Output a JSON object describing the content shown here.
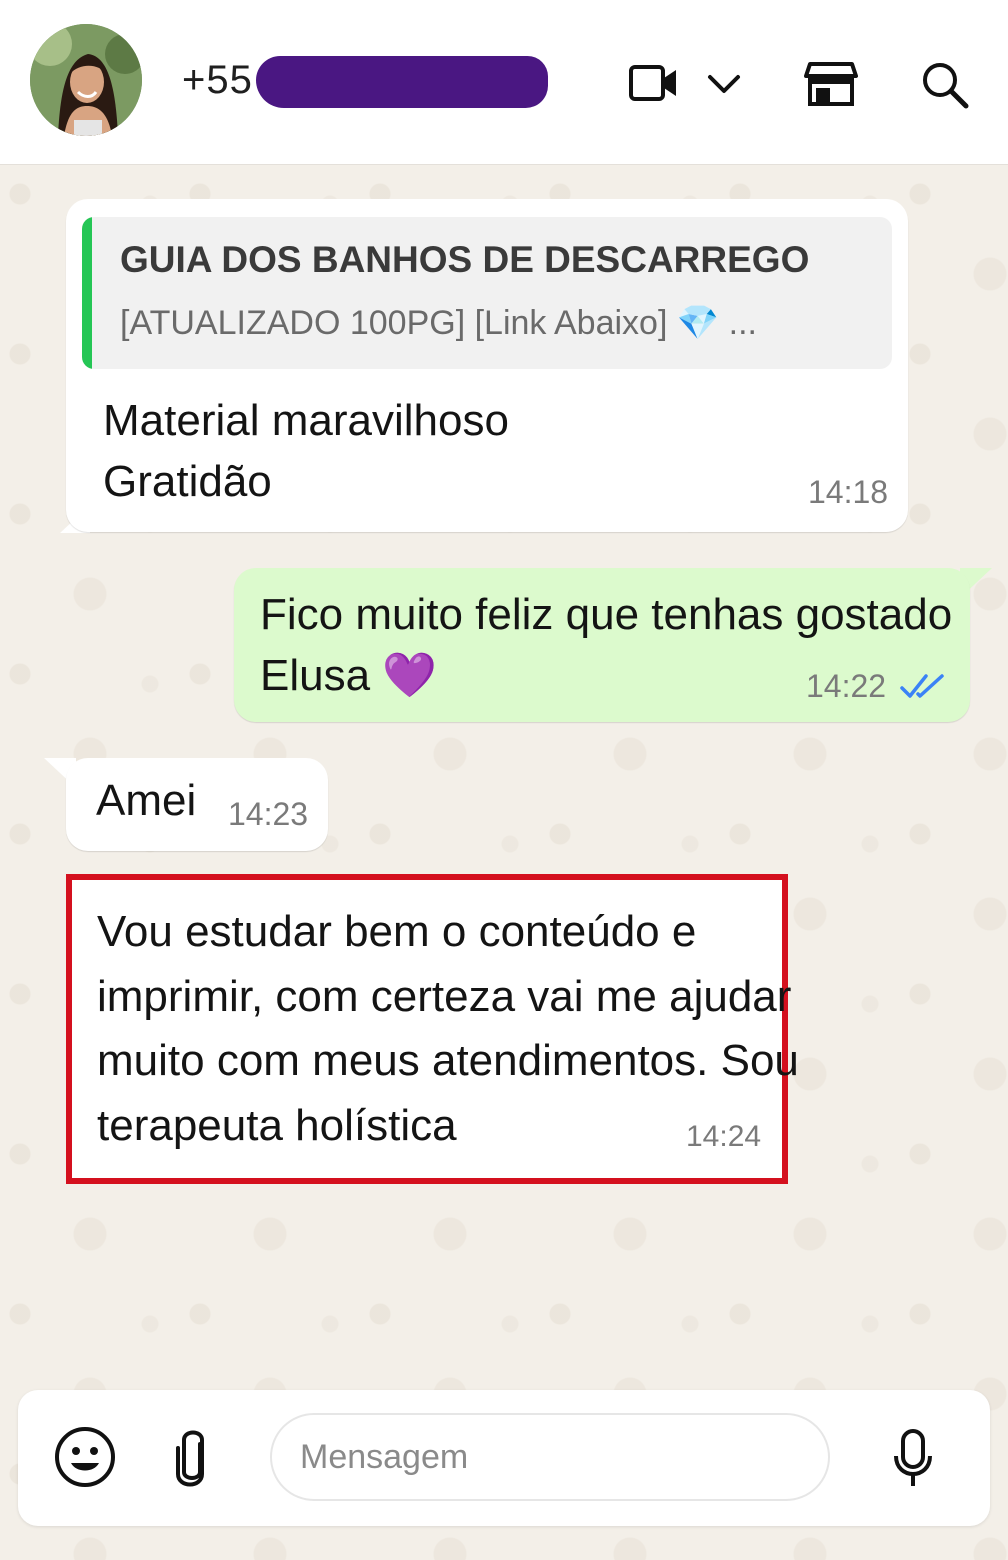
{
  "header": {
    "contact_number": "+55",
    "icons": [
      "avatar",
      "video-call-icon",
      "chevron-down-icon",
      "shop-icon",
      "search-icon"
    ]
  },
  "messages": [
    {
      "direction": "incoming",
      "quote_title": "GUIA DOS BANHOS DE DESCARREGO",
      "quote_subtitle": "[ATUALIZADO 100PG] [Link Abaixo]",
      "quote_emoji": "💎",
      "quote_ellipsis": "...",
      "lines": [
        "Material maravilhoso",
        "Gratidão"
      ],
      "time": "14:18"
    },
    {
      "direction": "outgoing",
      "lines": [
        "Fico muito feliz que tenhas gostado",
        "Elusa"
      ],
      "emoji": "💜",
      "time": "14:22",
      "status": "read"
    },
    {
      "direction": "incoming",
      "lines": [
        "Amei"
      ],
      "time": "14:23"
    },
    {
      "direction": "incoming",
      "highlighted": true,
      "lines": [
        "Vou estudar bem o conteúdo e",
        "imprimir, com certeza vai me ajudar",
        "muito com meus atendimentos. Sou",
        "terapeuta holística"
      ],
      "time": "14:24"
    }
  ],
  "composer": {
    "placeholder": "Mensagem"
  },
  "colors": {
    "outgoing_bubble": "#dcfacd",
    "incoming_bubble": "#ffffff",
    "quote_bar": "#25c655",
    "highlight_border": "#d4101e",
    "read_ticks": "#3b82f6",
    "redaction": "#4a1782"
  }
}
